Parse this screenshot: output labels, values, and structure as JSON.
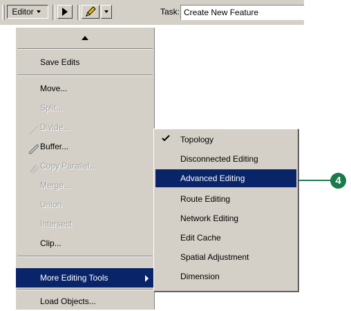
{
  "toolbar": {
    "editor_label": "Editor",
    "task_label": "Task:",
    "task_value": "Create New Feature"
  },
  "editor_menu": {
    "items": [
      {
        "label": "Save Edits",
        "enabled": true
      },
      {
        "label": "Move...",
        "enabled": true
      },
      {
        "label": "Split...",
        "enabled": false
      },
      {
        "label": "Divide...",
        "enabled": false,
        "icon": "divide-icon"
      },
      {
        "label": "Buffer...",
        "enabled": true,
        "icon": "buffer-icon"
      },
      {
        "label": "Copy Parallel...",
        "enabled": false,
        "icon": "copy-parallel-icon"
      },
      {
        "label": "Merge...",
        "enabled": false
      },
      {
        "label": "Union",
        "enabled": false
      },
      {
        "label": "Intersect",
        "enabled": false
      },
      {
        "label": "Clip...",
        "enabled": true
      },
      {
        "label": "More Editing Tools",
        "enabled": true,
        "highlighted": true,
        "has_submenu": true
      },
      {
        "label": "Load Objects...",
        "enabled": true
      }
    ]
  },
  "submenu": {
    "items": [
      {
        "label": "Topology",
        "checked": true
      },
      {
        "label": "Disconnected Editing"
      },
      {
        "label": "Advanced Editing",
        "highlighted": true
      },
      {
        "label": "Route Editing"
      },
      {
        "label": "Network Editing"
      },
      {
        "label": "Edit Cache"
      },
      {
        "label": "Spatial Adjustment"
      },
      {
        "label": "Dimension"
      }
    ]
  },
  "callout": {
    "number": "4",
    "color": "#1a7a4c"
  },
  "colors": {
    "menu_bg": "#d4d0c8",
    "highlight": "#0a246a",
    "disabled_text": "#a0a0a0"
  }
}
